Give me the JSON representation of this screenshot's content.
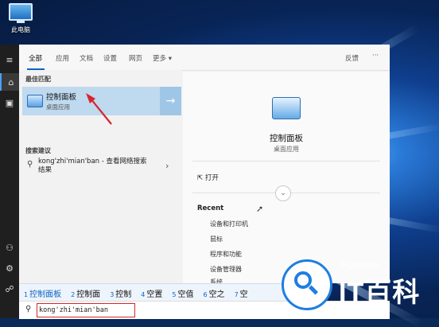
{
  "desktop": {
    "icon_label": "此电脑"
  },
  "tabs": {
    "items": [
      "全部",
      "应用",
      "文档",
      "设置",
      "网页",
      "更多 ▾"
    ],
    "feedback": "反馈",
    "more": "···"
  },
  "left": {
    "best_match_header": "最佳匹配",
    "best_match": {
      "title": "控制面板",
      "subtitle": "桌面应用"
    },
    "suggest_header": "搜索建议",
    "suggestion": {
      "text": "kong'zhi'mian'ban - 查看网络搜索结果"
    }
  },
  "right": {
    "title": "控制面板",
    "subtitle": "桌面应用",
    "open": "打开",
    "recent_header": "Recent",
    "recent_items": [
      "设备和打印机",
      "鼠标",
      "程序和功能",
      "设备管理器",
      "系统"
    ]
  },
  "ime": {
    "candidates": [
      {
        "num": "1",
        "text": "控制面板"
      },
      {
        "num": "2",
        "text": "控制面"
      },
      {
        "num": "3",
        "text": "控制"
      },
      {
        "num": "4",
        "text": "空置"
      },
      {
        "num": "5",
        "text": "空值"
      },
      {
        "num": "6",
        "text": "空之"
      },
      {
        "num": "7",
        "text": "空"
      }
    ]
  },
  "search": {
    "value": "kong'zhi'mian'ban"
  },
  "watermark": {
    "small": "PConline",
    "big": "IT百科"
  },
  "colors": {
    "accent": "#0a64c8",
    "highlight": "#bfd9ef",
    "annotation_red": "#d6262b"
  }
}
